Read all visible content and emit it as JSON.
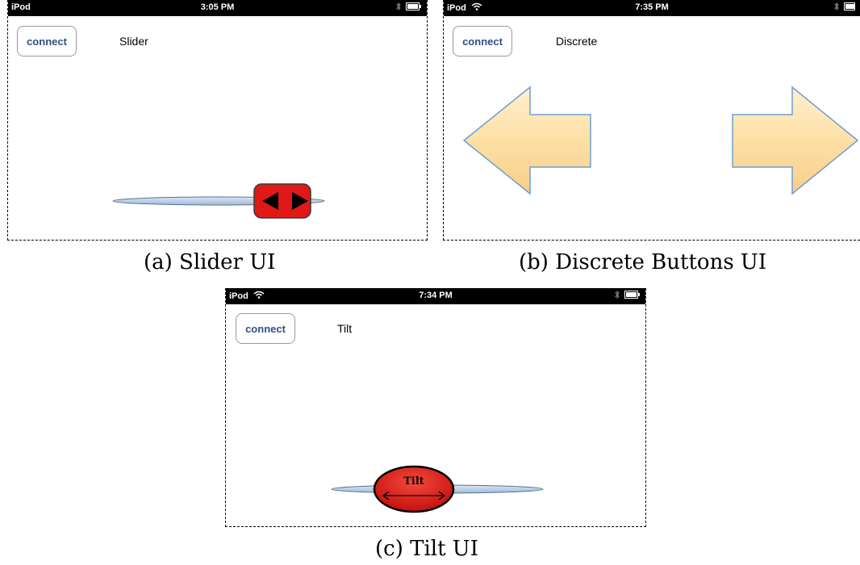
{
  "panels": [
    {
      "carrier": "iPod",
      "time": "3:05 PM",
      "connect_label": "connect",
      "mode_label": "Slider",
      "caption": "(a) Slider UI"
    },
    {
      "carrier": "iPod",
      "time": "7:35 PM",
      "connect_label": "connect",
      "mode_label": "Discrete",
      "caption": "(b) Discrete Buttons UI"
    },
    {
      "carrier": "iPod",
      "time": "7:34 PM",
      "connect_label": "connect",
      "mode_label": "Tilt",
      "caption": "(c) Tilt UI",
      "knob_label": "Tilt"
    }
  ],
  "colors": {
    "status_bar": "#000000",
    "connect_text": "#334e84",
    "track": "#b8cfe6",
    "knob_red": "#e01818",
    "arrow_fill": "#fde0a6",
    "arrow_outline": "#6f9ed0"
  },
  "icons": {
    "wifi": "wifi-icon",
    "bluetooth": "bluetooth-icon",
    "battery": "battery-icon",
    "slider_knob": "left-right-arrows-icon",
    "left_arrow": "left-arrow-icon",
    "right_arrow": "right-arrow-icon"
  }
}
